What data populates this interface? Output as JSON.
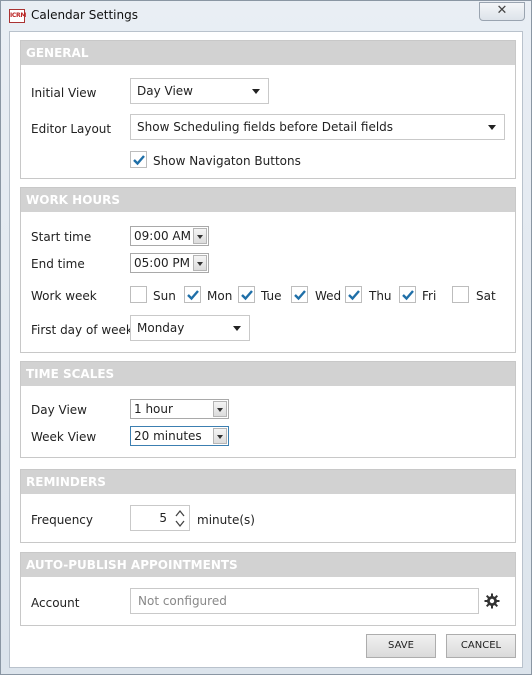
{
  "window": {
    "title": "Calendar Settings",
    "app_icon_text": "ICRM",
    "close_glyph": "✕"
  },
  "general": {
    "header": "GENERAL",
    "initial_view_label": "Initial View",
    "initial_view_value": "Day View",
    "editor_layout_label": "Editor Layout",
    "editor_layout_value": "Show Scheduling fields before Detail fields",
    "show_nav_label": "Show Navigaton Buttons",
    "show_nav_checked": true
  },
  "work_hours": {
    "header": "WORK HOURS",
    "start_label": "Start time",
    "start_value": "09:00 AM",
    "end_label": "End time",
    "end_value": "05:00 PM",
    "work_week_label": "Work week",
    "days": [
      {
        "label": "Sun",
        "checked": false
      },
      {
        "label": "Mon",
        "checked": true
      },
      {
        "label": "Tue",
        "checked": true
      },
      {
        "label": "Wed",
        "checked": true
      },
      {
        "label": "Thu",
        "checked": true
      },
      {
        "label": "Fri",
        "checked": true
      },
      {
        "label": "Sat",
        "checked": false
      }
    ],
    "first_day_label": "First day of week",
    "first_day_value": "Monday"
  },
  "time_scales": {
    "header": "TIME SCALES",
    "day_view_label": "Day View",
    "day_view_value": "1 hour",
    "week_view_label": "Week View",
    "week_view_value": "20 minutes"
  },
  "reminders": {
    "header": "REMINDERS",
    "frequency_label": "Frequency",
    "frequency_value": "5",
    "unit": "minute(s)"
  },
  "auto_publish": {
    "header": "AUTO-PUBLISH APPOINTMENTS",
    "account_label": "Account",
    "account_value": "Not configured"
  },
  "buttons": {
    "save": "SAVE",
    "cancel": "CANCEL"
  },
  "colors": {
    "group_header": "#d2d2d2",
    "check": "#1f6fa8",
    "focus_border": "#3c7fb1"
  }
}
